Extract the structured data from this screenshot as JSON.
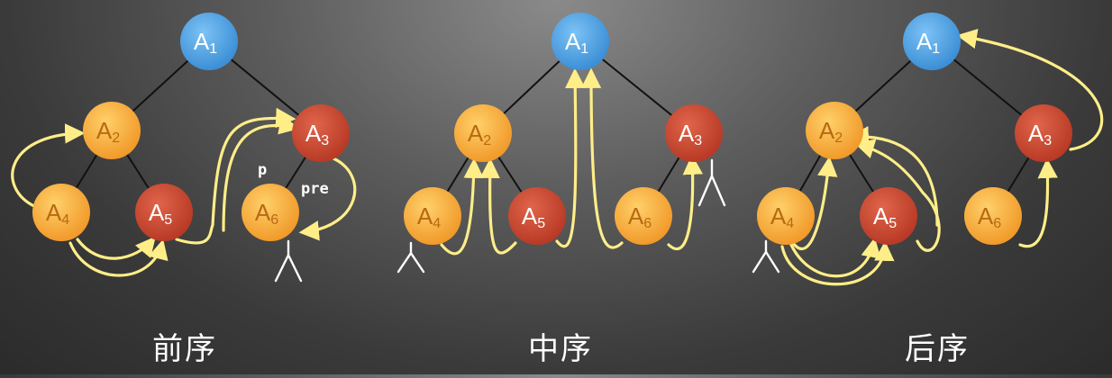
{
  "colors": {
    "root": "#4a9fe0",
    "orange": "#f5a93b",
    "red": "#c7462f",
    "edge": "#111111",
    "arrow": "#ffee88",
    "leaf": "#ffffff"
  },
  "panels": [
    {
      "caption": "前序",
      "labels": [
        {
          "name": "p",
          "text": "p"
        },
        {
          "name": "pre",
          "text": "pre"
        }
      ],
      "nodes": [
        {
          "id": "A1",
          "base": "A",
          "sub": "1",
          "color": "root"
        },
        {
          "id": "A2",
          "base": "A",
          "sub": "2",
          "color": "orange"
        },
        {
          "id": "A3",
          "base": "A",
          "sub": "3",
          "color": "red"
        },
        {
          "id": "A4",
          "base": "A",
          "sub": "4",
          "color": "orange"
        },
        {
          "id": "A5",
          "base": "A",
          "sub": "5",
          "color": "red"
        },
        {
          "id": "A6",
          "base": "A",
          "sub": "6",
          "color": "orange"
        }
      ]
    },
    {
      "caption": "中序",
      "nodes": [
        {
          "id": "A1",
          "base": "A",
          "sub": "1",
          "color": "root"
        },
        {
          "id": "A2",
          "base": "A",
          "sub": "2",
          "color": "orange"
        },
        {
          "id": "A3",
          "base": "A",
          "sub": "3",
          "color": "red"
        },
        {
          "id": "A4",
          "base": "A",
          "sub": "4",
          "color": "orange"
        },
        {
          "id": "A5",
          "base": "A",
          "sub": "5",
          "color": "red"
        },
        {
          "id": "A6",
          "base": "A",
          "sub": "6",
          "color": "orange"
        }
      ]
    },
    {
      "caption": "后序",
      "nodes": [
        {
          "id": "A1",
          "base": "A",
          "sub": "1",
          "color": "root"
        },
        {
          "id": "A2",
          "base": "A",
          "sub": "2",
          "color": "orange"
        },
        {
          "id": "A3",
          "base": "A",
          "sub": "3",
          "color": "red"
        },
        {
          "id": "A4",
          "base": "A",
          "sub": "4",
          "color": "orange"
        },
        {
          "id": "A5",
          "base": "A",
          "sub": "5",
          "color": "red"
        },
        {
          "id": "A6",
          "base": "A",
          "sub": "6",
          "color": "orange"
        }
      ]
    }
  ]
}
